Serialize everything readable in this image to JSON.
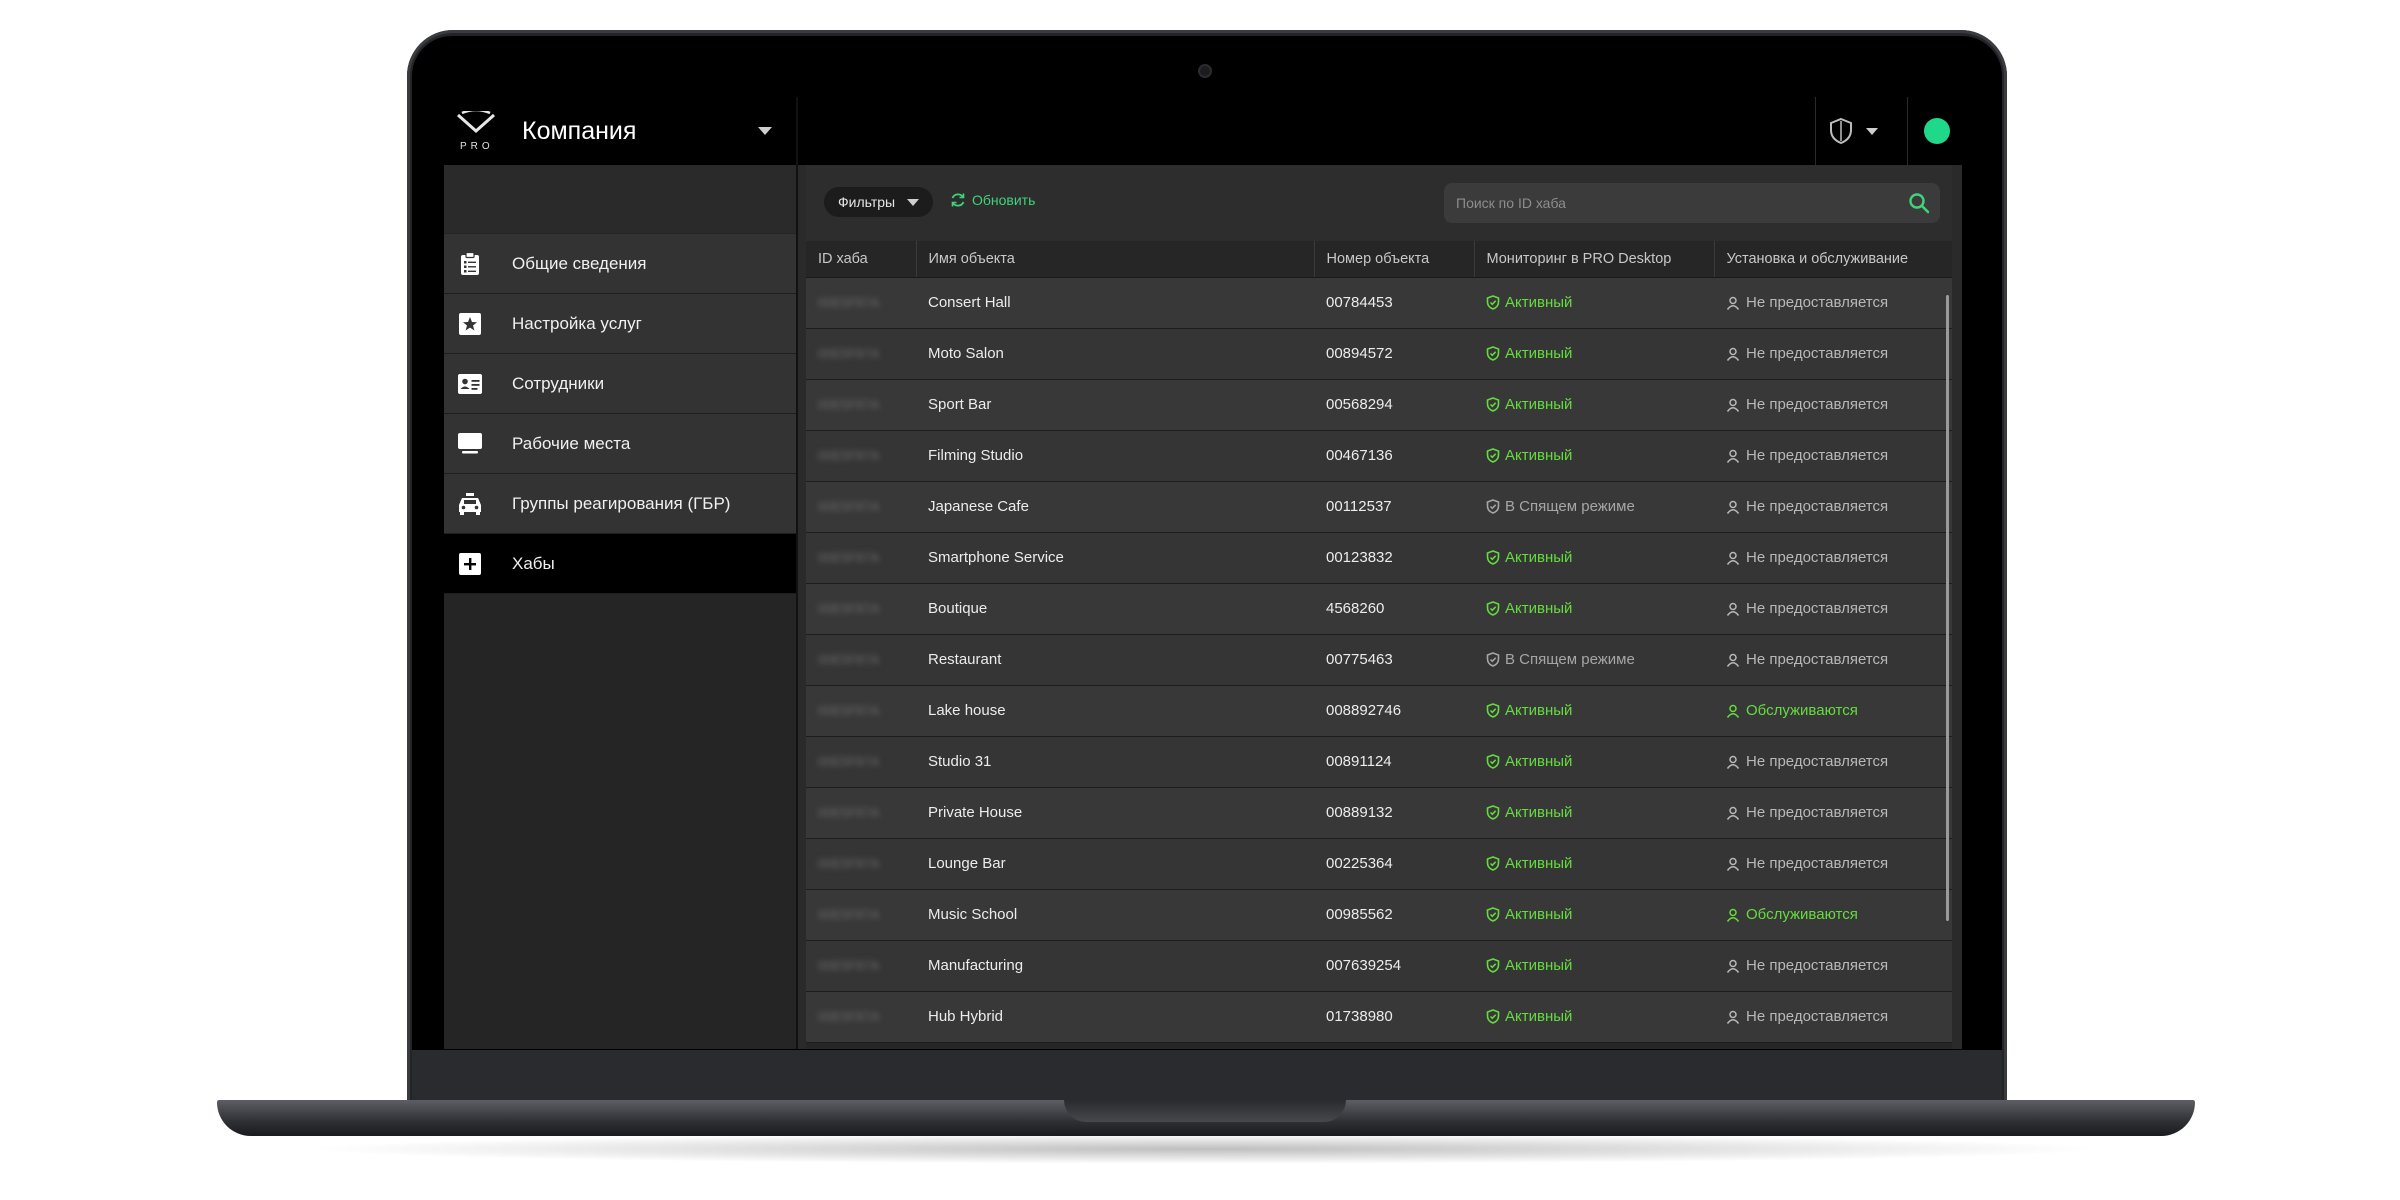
{
  "header": {
    "company_name": "Компания",
    "logo_text": "PRO"
  },
  "sidebar": {
    "items": [
      {
        "label": "Общие сведения",
        "icon": "clipboard-icon"
      },
      {
        "label": "Настройка услуг",
        "icon": "star-icon"
      },
      {
        "label": "Сотрудники",
        "icon": "id-card-icon"
      },
      {
        "label": "Рабочие места",
        "icon": "monitor-icon"
      },
      {
        "label": "Группы реагирования (ГБР)",
        "icon": "car-icon"
      },
      {
        "label": "Хабы",
        "icon": "plus-box-icon",
        "active": true
      }
    ]
  },
  "topbar": {
    "icons": [
      "shield-icon",
      "chevron-down-icon",
      "status-dot"
    ]
  },
  "toolbar": {
    "filters_label": "Фильтры",
    "refresh_label": "Обновить",
    "search_placeholder": "Поиск по ID хаба"
  },
  "table": {
    "columns": [
      "ID хаба",
      "Имя объекта",
      "Номер объекта",
      "Мониторинг в PRO Desktop",
      "Установка и обслуживание"
    ],
    "rows": [
      {
        "hub_id": "00E5F87A",
        "name": "Consert Hall",
        "number": "00784453",
        "monitoring": "Активный",
        "monitoring_state": "active",
        "service": "Не предоставляется",
        "service_state": "none"
      },
      {
        "hub_id": "00E5F87A",
        "name": "Moto Salon",
        "number": "00894572",
        "monitoring": "Активный",
        "monitoring_state": "active",
        "service": "Не предоставляется",
        "service_state": "none"
      },
      {
        "hub_id": "00E5F87A",
        "name": "Sport Bar",
        "number": "00568294",
        "monitoring": "Активный",
        "monitoring_state": "active",
        "service": "Не предоставляется",
        "service_state": "none"
      },
      {
        "hub_id": "00E5F87A",
        "name": "Filming Studio",
        "number": "00467136",
        "monitoring": "Активный",
        "monitoring_state": "active",
        "service": "Не предоставляется",
        "service_state": "none"
      },
      {
        "hub_id": "00E5F87A",
        "name": "Japanese Cafe",
        "number": "00112537",
        "monitoring": "В Спящем режиме",
        "monitoring_state": "sleep",
        "service": "Не предоставляется",
        "service_state": "none"
      },
      {
        "hub_id": "00E5F87A",
        "name": "Smartphone Service",
        "number": "00123832",
        "monitoring": "Активный",
        "monitoring_state": "active",
        "service": "Не предоставляется",
        "service_state": "none"
      },
      {
        "hub_id": "00E5F87A",
        "name": "Boutique",
        "number": "4568260",
        "monitoring": "Активный",
        "monitoring_state": "active",
        "service": "Не предоставляется",
        "service_state": "none"
      },
      {
        "hub_id": "00E5F87A",
        "name": "Restaurant",
        "number": "00775463",
        "monitoring": "В Спящем режиме",
        "monitoring_state": "sleep",
        "service": "Не предоставляется",
        "service_state": "none"
      },
      {
        "hub_id": "00E5F87A",
        "name": "Lake house",
        "number": "008892746",
        "monitoring": "Активный",
        "monitoring_state": "active",
        "service": "Обслуживаются",
        "service_state": "yes"
      },
      {
        "hub_id": "00E5F87A",
        "name": "Studio 31",
        "number": "00891124",
        "monitoring": "Активный",
        "monitoring_state": "active",
        "service": "Не предоставляется",
        "service_state": "none"
      },
      {
        "hub_id": "00E5F87A",
        "name": "Private House",
        "number": "00889132",
        "monitoring": "Активный",
        "monitoring_state": "active",
        "service": "Не предоставляется",
        "service_state": "none"
      },
      {
        "hub_id": "00E5F87A",
        "name": "Lounge Bar",
        "number": "00225364",
        "monitoring": "Активный",
        "monitoring_state": "active",
        "service": "Не предоставляется",
        "service_state": "none"
      },
      {
        "hub_id": "00E5F87A",
        "name": "Music School",
        "number": "00985562",
        "monitoring": "Активный",
        "monitoring_state": "active",
        "service": "Обслуживаются",
        "service_state": "yes"
      },
      {
        "hub_id": "00E5F87A",
        "name": "Manufacturing",
        "number": "007639254",
        "monitoring": "Активный",
        "monitoring_state": "active",
        "service": "Не предоставляется",
        "service_state": "none"
      },
      {
        "hub_id": "00E5F87A",
        "name": "Hub Hybrid",
        "number": "01738980",
        "monitoring": "Активный",
        "monitoring_state": "active",
        "service": "Не предоставляется",
        "service_state": "none"
      }
    ]
  },
  "colors": {
    "accent_green": "#64dc3e",
    "status_dot": "#1fd88a",
    "sleep_gray": "#a6a6a6"
  }
}
